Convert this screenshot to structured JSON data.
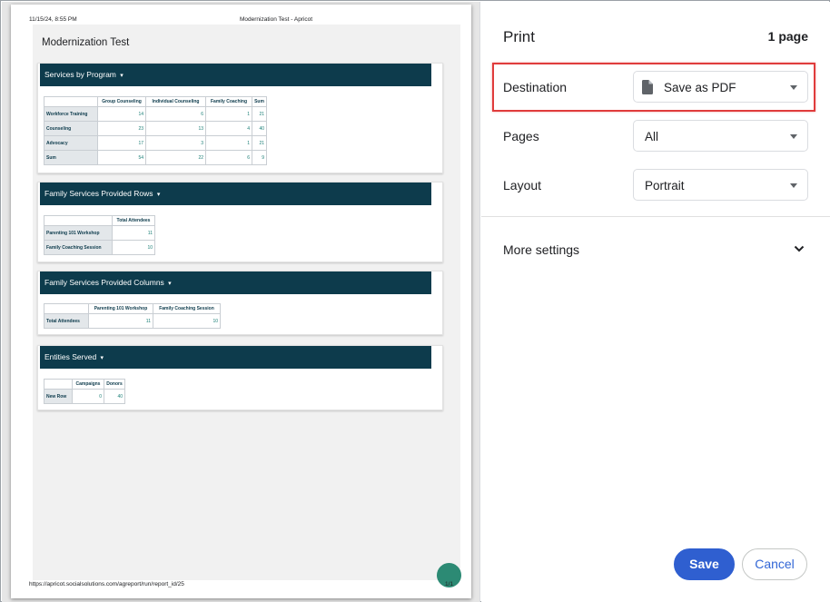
{
  "preview": {
    "header_datetime": "11/15/24, 8:55 PM",
    "header_title": "Modernization Test - Apricot",
    "footer_url": "https://apricot.socialsolutions.com/agreport/run/report_id/25",
    "footer_page": "1/1",
    "report_title": "Modernization Test",
    "sections": [
      {
        "title": "Services by Program",
        "columns": [
          "Group Counseling",
          "Individual Counseling",
          "Family Coaching",
          "Sum"
        ],
        "rows": [
          {
            "label": "Workforce Training",
            "values": [
              "14",
              "6",
              "1",
              "21"
            ]
          },
          {
            "label": "Counseling",
            "values": [
              "23",
              "13",
              "4",
              "40"
            ]
          },
          {
            "label": "Advocacy",
            "values": [
              "17",
              "3",
              "1",
              "21"
            ]
          },
          {
            "label": "Sum",
            "values": [
              "54",
              "22",
              "6",
              "9"
            ]
          }
        ]
      },
      {
        "title": "Family Services Provided Rows",
        "columns": [
          "Total Attendees"
        ],
        "rows": [
          {
            "label": "Parenting 101 Workshop",
            "values": [
              "11"
            ]
          },
          {
            "label": "Family Coaching Session",
            "values": [
              "10"
            ]
          }
        ]
      },
      {
        "title": "Family Services Provided Columns",
        "columns": [
          "Parenting 101 Workshop",
          "Family Coaching Session"
        ],
        "rows": [
          {
            "label": "Total Attendees",
            "values": [
              "11",
              "10"
            ]
          }
        ]
      },
      {
        "title": "Entities Served",
        "columns": [
          "Campaigns",
          "Donors"
        ],
        "rows": [
          {
            "label": "New Row",
            "values": [
              "0",
              "40"
            ]
          }
        ]
      }
    ],
    "caret_glyph": "▾"
  },
  "settings": {
    "title": "Print",
    "page_count": "1 page",
    "destination": {
      "label": "Destination",
      "value": "Save as PDF",
      "icon": "document-icon"
    },
    "pages": {
      "label": "Pages",
      "value": "All"
    },
    "layout": {
      "label": "Layout",
      "value": "Portrait"
    },
    "more_settings": "More settings",
    "save_label": "Save",
    "cancel_label": "Cancel"
  },
  "colors": {
    "section_header": "#0d3b4c",
    "number_text": "#1b7f77",
    "save_button": "#2f5fd0",
    "highlight": "#e03c3c",
    "fab": "#2c8a74"
  }
}
